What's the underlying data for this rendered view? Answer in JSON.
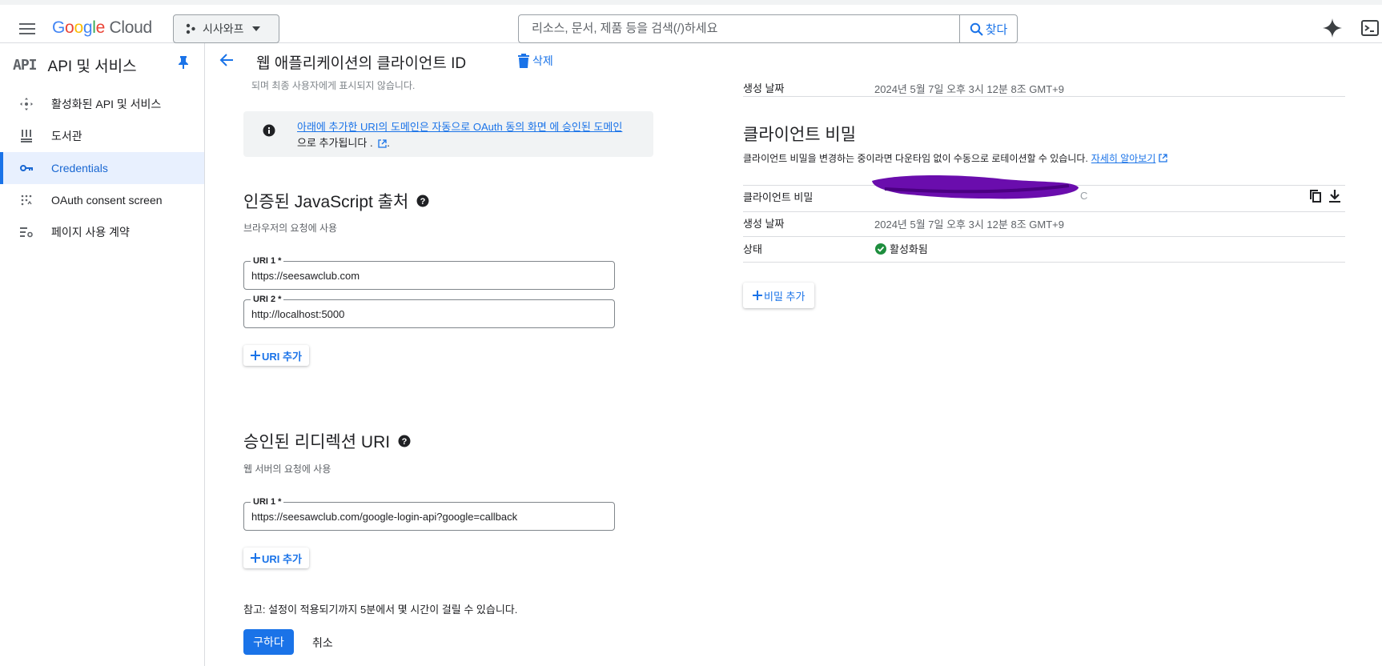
{
  "topbar": {
    "logo_text": "Google Cloud",
    "project_name": "시사와프",
    "search_placeholder": "리소스, 문서, 제품 등을 검색(/)하세요",
    "search_button": "찾다"
  },
  "sidebar": {
    "title": "API 및 서비스",
    "items": [
      {
        "label": "활성화된 API 및 서비스",
        "icon": "api-diamond-icon"
      },
      {
        "label": "도서관",
        "icon": "library-icon"
      },
      {
        "label": "Credentials",
        "icon": "key-icon",
        "active": true
      },
      {
        "label": "OAuth consent screen",
        "icon": "consent-dots-icon"
      },
      {
        "label": "페이지 사용 계약",
        "icon": "settings-list-icon"
      }
    ]
  },
  "header": {
    "title": "웹 애플리케이션의 클라이언트 ID",
    "delete_label": "삭제"
  },
  "left": {
    "faded_text": "되며 최종 사용자에게 표시되지 않습니다.",
    "info_line1": "아래에 추가한 URI의 도메인은 자동으로 OAuth 동의 화면 에 승인된 도메인",
    "info_line2": "으로 추가됩니다 .",
    "js_origins": {
      "title": "인증된 JavaScript 출처",
      "subtitle": "브라우저의 요청에 사용",
      "uris": [
        {
          "label": "URI 1 *",
          "value": "https://seesawclub.com"
        },
        {
          "label": "URI 2 *",
          "value": "http://localhost:5000"
        }
      ],
      "add_label": "URI 추가"
    },
    "redirects": {
      "title": "승인된 리디렉션 URI",
      "subtitle": "웹 서버의 요청에 사용",
      "uris": [
        {
          "label": "URI 1 *",
          "value": "https://seesawclub.com/google-login-api?google=callback"
        }
      ],
      "add_label": "URI 추가"
    },
    "note": "참고: 설정이 적용되기까지 5분에서 몇 시간이 걸릴 수 있습니다.",
    "save_label": "구하다",
    "cancel_label": "취소"
  },
  "right": {
    "created_label": "생성 날짜",
    "created_value": "2024년 5월 7일 오후 3시 12분 8조 GMT+9",
    "secret_title": "클라이언트 비밀",
    "secret_desc": "클라이언트 비밀을 변경하는 중이라면 다운타임 없이 수동으로 로테이션할 수 있습니다.",
    "learn_more": "자세히 알아보기",
    "secret_label": "클라이언트 비밀",
    "secret_value_tail": "C",
    "secret_created_label": "생성 날짜",
    "secret_created_value": "2024년 5월 7일 오후 3시 12분 8조 GMT+9",
    "status_label": "상태",
    "status_value": "활성화됨",
    "add_secret_label": "비밀 추가"
  },
  "colors": {
    "accent": "#1a73e8",
    "active_bg": "#e8f0fe",
    "success": "#1e8e3e",
    "redaction": "#6a0dad"
  }
}
